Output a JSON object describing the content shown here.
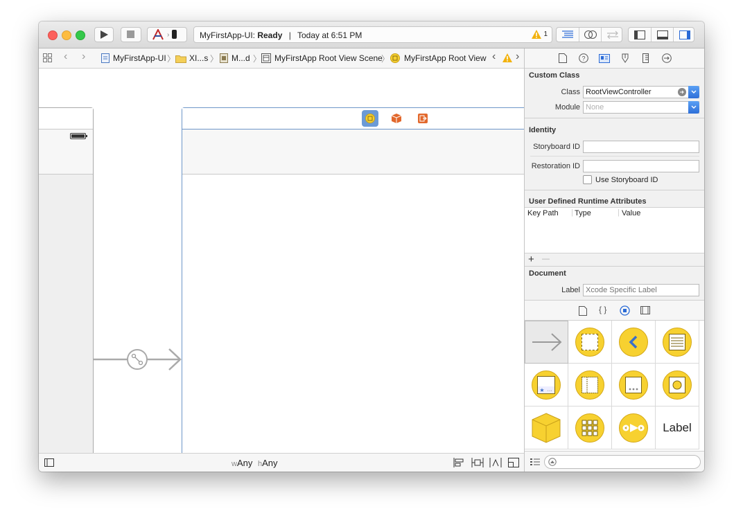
{
  "toolbar": {
    "scheme": "MyFirstApp-UI",
    "status_prefix": "MyFirstApp-UI: ",
    "status_state": "Ready",
    "status_time": "Today at 6:51 PM",
    "warning_count": "1",
    "icons": [
      "run-icon",
      "stop-icon",
      "scheme-icon",
      "device-icon",
      "warning-icon",
      "standard-editor-icon",
      "assistant-editor-icon",
      "version-editor-icon",
      "navigator-toggle-icon",
      "debug-area-toggle-icon",
      "utilities-toggle-icon"
    ]
  },
  "jumpbar": {
    "items": [
      {
        "label": "MyFirstApp-UI",
        "icon": "project-file-icon"
      },
      {
        "label": "XI...s",
        "icon": "folder-icon"
      },
      {
        "label": "M...d",
        "icon": "storyboard-file-icon"
      },
      {
        "label": "MyFirstApp Root View Scene",
        "icon": "scene-icon"
      },
      {
        "label": "MyFirstApp Root View",
        "icon": "view-controller-icon"
      }
    ]
  },
  "canvas": {
    "size_class_w_prefix": "w",
    "size_class_w": "Any",
    "size_class_h_prefix": "h",
    "size_class_h": "Any"
  },
  "inspector": {
    "custom_class": {
      "title": "Custom Class",
      "class_label": "Class",
      "class_value": "RootViewController",
      "module_label": "Module",
      "module_placeholder": "None"
    },
    "identity": {
      "title": "Identity",
      "storyboard_id_label": "Storyboard ID",
      "restoration_id_label": "Restoration ID",
      "use_storyboard_id_label": "Use Storyboard ID"
    },
    "runtime_attributes": {
      "title": "User Defined Runtime Attributes",
      "columns": [
        "Key Path",
        "Type",
        "Value"
      ],
      "add": "+",
      "remove": "—"
    },
    "document": {
      "title": "Document",
      "label_label": "Label",
      "label_placeholder": "Xcode Specific Label"
    }
  },
  "library": {
    "label_item": "Label",
    "colors": {
      "yellow": "#f7d130",
      "blue": "#3b6fc7",
      "orange": "#e2682c"
    }
  }
}
